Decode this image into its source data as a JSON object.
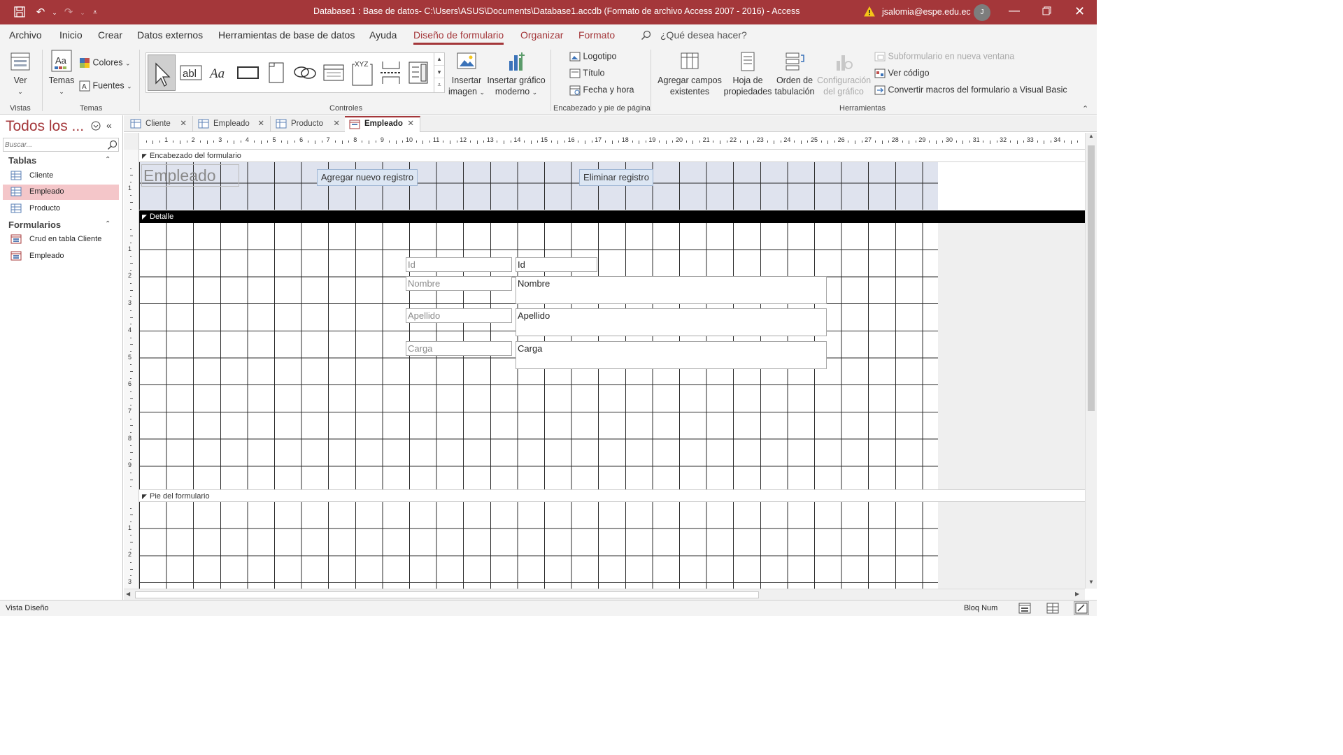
{
  "window": {
    "title": "Database1 : Base de datos- C:\\Users\\ASUS\\Documents\\Database1.accdb (Formato de archivo Access 2007 - 2016)  -  Access",
    "user": "jsalomia@espe.edu.ec",
    "avatar_initial": "J"
  },
  "menu": {
    "tabs": [
      "Archivo",
      "Inicio",
      "Crear",
      "Datos externos",
      "Herramientas de base de datos",
      "Ayuda",
      "Diseño de formulario",
      "Organizar",
      "Formato"
    ],
    "search_placeholder": "¿Qué desea hacer?"
  },
  "ribbon": {
    "views": {
      "ver": "Ver",
      "group": "Vistas"
    },
    "themes": {
      "temas": "Temas",
      "colores": "Colores",
      "fuentes": "Fuentes",
      "group": "Temas"
    },
    "controls": {
      "group": "Controles",
      "insertar_imagen": [
        "Insertar",
        "imagen"
      ],
      "insertar_grafico": [
        "Insertar gráfico",
        "moderno"
      ]
    },
    "header_footer": {
      "logotipo": "Logotipo",
      "titulo": "Título",
      "fecha_hora": "Fecha y hora",
      "group": "Encabezado y pie de página"
    },
    "tools": {
      "agregar_campos": [
        "Agregar campos",
        "existentes"
      ],
      "hoja_propiedades": [
        "Hoja de",
        "propiedades"
      ],
      "orden_tabulacion": [
        "Orden de",
        "tabulación"
      ],
      "configuracion_grafico": [
        "Configuración",
        "del gráfico"
      ],
      "subformulario": "Subformulario en nueva ventana",
      "ver_codigo": "Ver código",
      "convertir_macros": "Convertir macros del formulario a Visual Basic",
      "group": "Herramientas"
    }
  },
  "nav": {
    "title": "Todos los ...",
    "search_placeholder": "Buscar...",
    "groups": [
      {
        "name": "Tablas",
        "items": [
          "Cliente",
          "Empleado",
          "Producto"
        ]
      },
      {
        "name": "Formularios",
        "items": [
          "Crud en tabla Cliente",
          "Empleado"
        ]
      }
    ]
  },
  "doc_tabs": [
    {
      "label": "Cliente"
    },
    {
      "label": "Empleado"
    },
    {
      "label": "Producto"
    },
    {
      "label": "Empleado"
    }
  ],
  "ruler": {
    "numbers": [
      "1",
      "2",
      "3",
      "4",
      "5",
      "6",
      "7",
      "8",
      "9",
      "10",
      "11",
      "12",
      "13",
      "14",
      "15",
      "16",
      "17",
      "18",
      "19",
      "20",
      "21",
      "22",
      "23",
      "24",
      "25",
      "26",
      "27",
      "28",
      "29",
      "30",
      "31",
      "32",
      "33",
      "34"
    ]
  },
  "form": {
    "header_section": "Encabezado del formulario",
    "detail_section": "Detalle",
    "footer_section": "Pie del formulario",
    "title": "Empleado",
    "add_button": "Agregar nuevo registro",
    "delete_button": "Eliminar registro",
    "fields": [
      {
        "label": "Id",
        "value": "Id"
      },
      {
        "label": "Nombre",
        "value": "Nombre"
      },
      {
        "label": "Apellido",
        "value": "Apellido"
      },
      {
        "label": "Carga",
        "value": "Carga"
      }
    ]
  },
  "status": {
    "left": "Vista Diseño",
    "right": "Bloq Num"
  },
  "colors": {
    "accent": "#a4373a",
    "selected_nav": "#f4c6c9",
    "section_header": "#dfe3ee"
  }
}
